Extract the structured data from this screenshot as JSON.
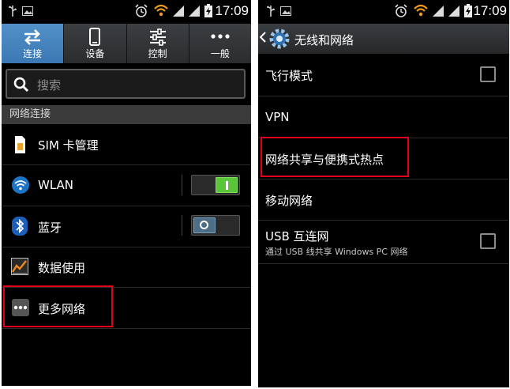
{
  "left": {
    "status": {
      "time": "17:09"
    },
    "tabs": [
      {
        "label": "连接",
        "icon": "swap-arrows-icon",
        "active": true
      },
      {
        "label": "设备",
        "icon": "phone-icon",
        "active": false
      },
      {
        "label": "控制",
        "icon": "sliders-icon",
        "active": false
      },
      {
        "label": "一般",
        "icon": "more-dots-icon",
        "active": false
      }
    ],
    "search": {
      "placeholder": "搜索"
    },
    "section_title": "网络连接",
    "items": [
      {
        "label": "SIM 卡管理",
        "icon": "sim-card-icon"
      },
      {
        "label": "WLAN",
        "icon": "wifi-icon",
        "toggle": "on"
      },
      {
        "label": "蓝牙",
        "icon": "bluetooth-icon",
        "toggle": "off"
      },
      {
        "label": "数据使用",
        "icon": "data-usage-icon"
      },
      {
        "label": "更多网络",
        "icon": "more-networks-icon",
        "highlighted": true
      }
    ]
  },
  "right": {
    "status": {
      "time": "17:09"
    },
    "title": "无线和网络",
    "items": [
      {
        "label": "飞行模式",
        "checkbox": false
      },
      {
        "label": "VPN"
      },
      {
        "label": "网络共享与便携式热点",
        "highlighted": true
      },
      {
        "label": "移动网络"
      },
      {
        "label": "USB 互连网",
        "summary": "通过 USB 线共享 Windows PC 网络",
        "checkbox": false
      }
    ]
  },
  "colors": {
    "accent_tab": "#3c78b3",
    "highlight_box": "#e1001a",
    "toggle_on": "#5cc43a",
    "toggle_off": "#4d6e86"
  }
}
